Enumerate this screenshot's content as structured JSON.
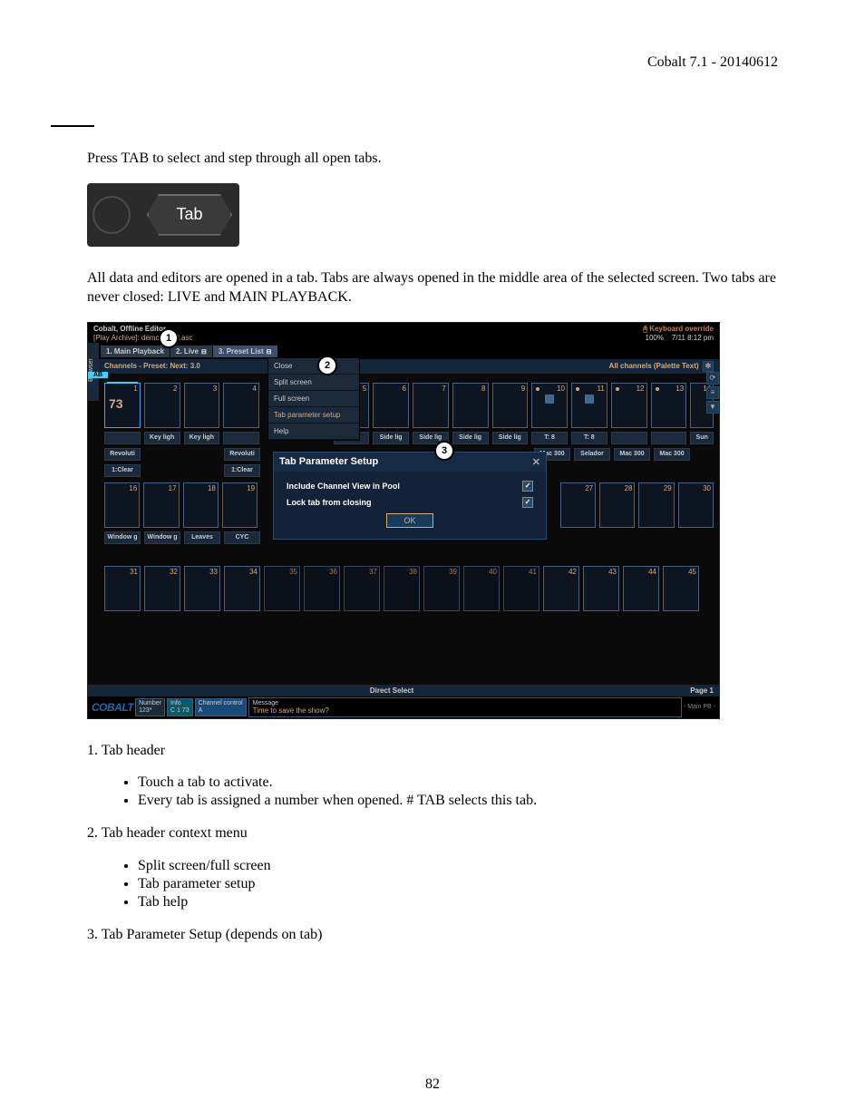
{
  "header": {
    "right": "Cobalt 7.1 - 20140612"
  },
  "para1": "Press TAB to select and step through all open tabs.",
  "tab_key_label": "Tab",
  "para2": "All data and editors are opened in a tab. Tabs are always opened in the middle area of the selected screen. Two tabs are never closed: LIVE and MAIN PLAYBACK.",
  "screenshot": {
    "top_left_line1": "Cobalt, Offline Editor",
    "top_left_line2_a": "[Play Archive]: demo",
    "top_left_line2_b": "anual.asc",
    "top_right_kb": "Keyboard override",
    "top_right_zoom": "100%",
    "top_right_time": "7/11 8:12 pm",
    "browser": "Browser",
    "tabs": [
      {
        "label": "1. Main Playback"
      },
      {
        "label": "2. Live"
      },
      {
        "label": "3. Preset List"
      }
    ],
    "tab_close": "Close",
    "subbar_left": "Channels - Preset:   Next: 3.0",
    "subbar_right": "All channels (Palette Text)",
    "subbar_ab": "AB",
    "cells_row1": [
      "1",
      "2",
      "3",
      "4",
      "5",
      "6",
      "7",
      "8",
      "9",
      "10",
      "11",
      "12",
      "13",
      "14",
      "1"
    ],
    "cell1_val": "73",
    "labels_row1": [
      "",
      "Key ligh",
      "Key ligh",
      "",
      "",
      "Side lig",
      "Side lig",
      "Side lig",
      "Side lig",
      "T: 8",
      "T: 8",
      "",
      "",
      "Sun"
    ],
    "labels_row1b": [
      "Revoluti",
      "",
      "",
      "Revoluti",
      "",
      "",
      "",
      "",
      "",
      "Mac 300",
      "Selador",
      "Mac 300",
      "Mac 300",
      ""
    ],
    "labels_row1c": [
      "1:Clear",
      "",
      "",
      "1:Clear",
      "",
      "",
      "",
      "",
      "",
      "",
      "",
      "",
      "",
      ""
    ],
    "cells_row2": [
      "16",
      "17",
      "18",
      "19",
      "",
      "",
      "",
      "",
      "",
      "",
      "27",
      "28",
      "29",
      "30"
    ],
    "labels_row2": [
      "Window g",
      "Window g",
      "Leaves",
      "CYC",
      "",
      "",
      "",
      "",
      "",
      "",
      "",
      "",
      "",
      ""
    ],
    "cells_row3": [
      "31",
      "32",
      "33",
      "34",
      "35",
      "36",
      "37",
      "38",
      "39",
      "40",
      "41",
      "42",
      "43",
      "44",
      "45"
    ],
    "ctx": {
      "split": "Split screen",
      "full": "Full screen",
      "setup": "Tab parameter setup",
      "help": "Help"
    },
    "dialog": {
      "title": "Tab Parameter Setup",
      "row1": "Include Channel View in Pool",
      "row2": "Lock tab from closing",
      "ok": "OK"
    },
    "callouts": {
      "c1": "1",
      "c2": "2",
      "c3": "3"
    },
    "direct_select": "Direct Select",
    "page": "Page 1",
    "status": {
      "logo": "COBALT",
      "num_lbl": "Number",
      "num_val": "123*",
      "info_lbl": "Info",
      "info_val": "C  1 73",
      "chan_lbl": "Channel control",
      "chan_val": "A",
      "msg_lbl": "Message",
      "msg_val": "Time to save the show?",
      "right": "- Main PB  -"
    }
  },
  "section1": {
    "heading": "1. Tab header",
    "b1": "Touch a tab to activate.",
    "b2": "Every tab is assigned a number when opened. # TAB selects this tab."
  },
  "section2": {
    "heading": "2. Tab header context menu",
    "b1": "Split screen/full screen",
    "b2": "Tab parameter setup",
    "b3": "Tab help"
  },
  "section3": {
    "heading": "3. Tab Parameter Setup (depends on tab)"
  },
  "page_number": "82"
}
